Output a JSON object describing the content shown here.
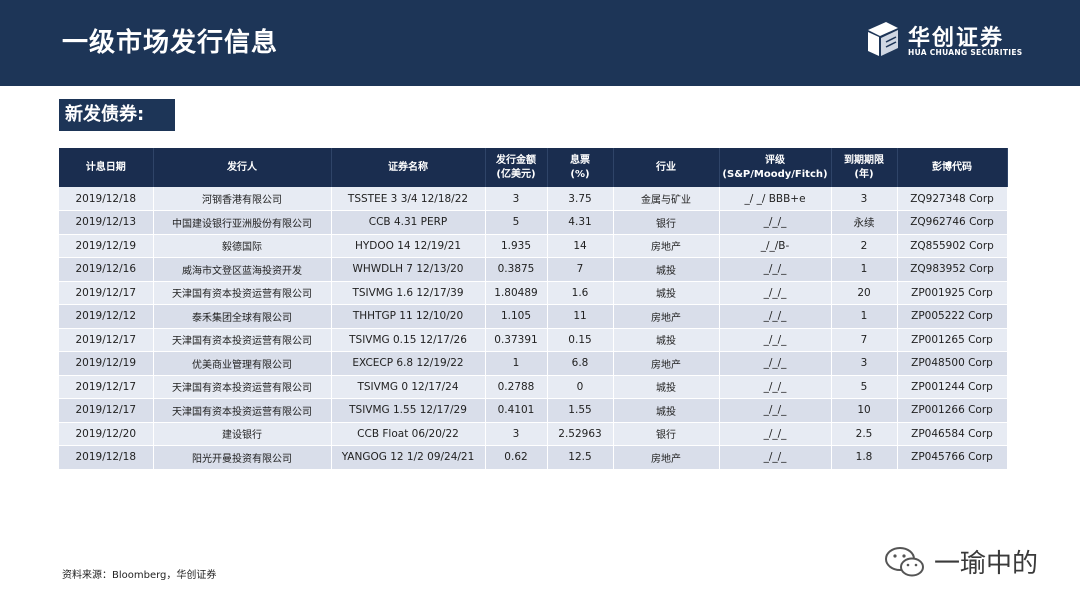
{
  "page": {
    "title": "一级市场发行信息",
    "section_label": "新发债券:",
    "source": "资料来源：Bloomberg，华创证券",
    "watermark": "一瑜中的"
  },
  "logo": {
    "cn": "华创证券",
    "en": "HUA CHUANG SECURITIES"
  },
  "colors": {
    "header_bg": "#1d3557",
    "table_header_bg": "#1a2d4f",
    "row_light": "#e7ebf3",
    "row_dark": "#d9deea"
  },
  "table": {
    "headers": [
      {
        "line1": "计息日期",
        "line2": ""
      },
      {
        "line1": "发行人",
        "line2": ""
      },
      {
        "line1": "证券名称",
        "line2": ""
      },
      {
        "line1": "发行金额",
        "line2": "(亿美元)"
      },
      {
        "line1": "息票",
        "line2": "(%)"
      },
      {
        "line1": "行业",
        "line2": ""
      },
      {
        "line1": "评级",
        "line2": "(S&P/Moody/Fitch)"
      },
      {
        "line1": "到期期限",
        "line2": "(年)"
      },
      {
        "line1": "彭博代码",
        "line2": ""
      }
    ],
    "rows": [
      [
        "2019/12/18",
        "河钢香港有限公司",
        "TSSTEE 3 3/4 12/18/22",
        "3",
        "3.75",
        "金属与矿业",
        "_/ _/ BBB+e",
        "3",
        "ZQ927348 Corp"
      ],
      [
        "2019/12/13",
        "中国建设银行亚洲股份有限公司",
        "CCB 4.31 PERP",
        "5",
        "4.31",
        "银行",
        "_/_/_",
        "永续",
        "ZQ962746 Corp"
      ],
      [
        "2019/12/19",
        "毅德国际",
        "HYDOO 14 12/19/21",
        "1.935",
        "14",
        "房地产",
        "_/_/B-",
        "2",
        "ZQ855902 Corp"
      ],
      [
        "2019/12/16",
        "威海市文登区蓝海投资开发",
        "WHWDLH 7 12/13/20",
        "0.3875",
        "7",
        "城投",
        "_/_/_",
        "1",
        "ZQ983952 Corp"
      ],
      [
        "2019/12/17",
        "天津国有资本投资运营有限公司",
        "TSIVMG 1.6 12/17/39",
        "1.80489",
        "1.6",
        "城投",
        "_/_/_",
        "20",
        "ZP001925 Corp"
      ],
      [
        "2019/12/12",
        "泰禾集团全球有限公司",
        "THHTGP 11 12/10/20",
        "1.105",
        "11",
        "房地产",
        "_/_/_",
        "1",
        "ZP005222 Corp"
      ],
      [
        "2019/12/17",
        "天津国有资本投资运营有限公司",
        "TSIVMG 0.15 12/17/26",
        "0.37391",
        "0.15",
        "城投",
        "_/_/_",
        "7",
        "ZP001265 Corp"
      ],
      [
        "2019/12/19",
        "优美商业管理有限公司",
        "EXCECP 6.8 12/19/22",
        "1",
        "6.8",
        "房地产",
        "_/_/_",
        "3",
        "ZP048500 Corp"
      ],
      [
        "2019/12/17",
        "天津国有资本投资运营有限公司",
        "TSIVMG 0 12/17/24",
        "0.2788",
        "0",
        "城投",
        "_/_/_",
        "5",
        "ZP001244 Corp"
      ],
      [
        "2019/12/17",
        "天津国有资本投资运营有限公司",
        "TSIVMG 1.55 12/17/29",
        "0.4101",
        "1.55",
        "城投",
        "_/_/_",
        "10",
        "ZP001266 Corp"
      ],
      [
        "2019/12/20",
        "建设银行",
        "CCB Float 06/20/22",
        "3",
        "2.52963",
        "银行",
        "_/_/_",
        "2.5",
        "ZP046584 Corp"
      ],
      [
        "2019/12/18",
        "阳光开曼投资有限公司",
        "YANGOG 12 1/2 09/24/21",
        "0.62",
        "12.5",
        "房地产",
        "_/_/_",
        "1.8",
        "ZP045766 Corp"
      ]
    ]
  }
}
